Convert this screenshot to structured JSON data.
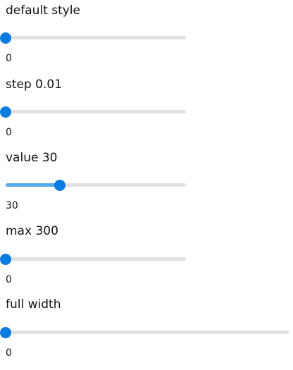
{
  "sliders": [
    {
      "label": "default style",
      "value": 0,
      "value_text": "0",
      "min": 0,
      "max": 100,
      "step": 1
    },
    {
      "label": "step 0.01",
      "value": 0,
      "value_text": "0",
      "min": 0,
      "max": 100,
      "step": 0.01
    },
    {
      "label": "value 30",
      "value": 30,
      "value_text": "30",
      "min": 0,
      "max": 100,
      "step": 1
    },
    {
      "label": "max 300",
      "value": 0,
      "value_text": "0",
      "min": 0,
      "max": 300,
      "step": 1
    },
    {
      "label": "full width",
      "value": 0,
      "value_text": "0",
      "min": 0,
      "max": 100,
      "step": 1
    }
  ],
  "colors": {
    "track": "#e1e1e1",
    "fill": "#55aaee",
    "thumb": "#0a7be0"
  }
}
